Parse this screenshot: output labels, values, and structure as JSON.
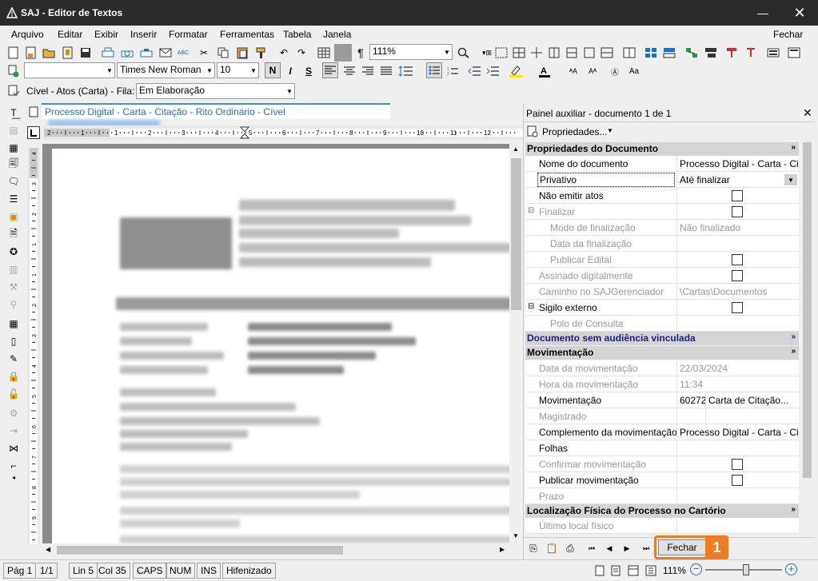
{
  "window": {
    "title": "SAJ - Editor de Textos",
    "minimize": "—",
    "close": "✕"
  },
  "menu": {
    "items": [
      "Arquivo",
      "Editar",
      "Exibir",
      "Inserir",
      "Formatar",
      "Ferramentas",
      "Tabela",
      "Janela"
    ],
    "close_label": "Fechar"
  },
  "toolbar": {
    "zoom": "111%",
    "font_name": "Times New Roman",
    "font_size": "10",
    "bold": "N",
    "italic": "I",
    "strike": "S",
    "pilcrow": "¶"
  },
  "queue": {
    "label": "Cível - Atos (Carta) - Fila:",
    "value": "Em Elaboração"
  },
  "document_tab": {
    "title": "Processo Digital - Carta - Citação - Rito Ordinário - Cível"
  },
  "ruler": {
    "h_ticks": [
      "2",
      "1",
      "1",
      "2",
      "3",
      "4",
      "5",
      "6",
      "7",
      "8",
      "9",
      "10",
      "11",
      "12"
    ],
    "v_ticks": [
      "4",
      "3",
      "2",
      "1",
      "1",
      "2",
      "3",
      "4",
      "5",
      "6",
      "7",
      "8",
      "9"
    ]
  },
  "panel": {
    "title": "Painel auxiliar - documento 1 de 1",
    "properties_button": "Propriedades...",
    "sections": {
      "doc_props": "Propriedades do Documento",
      "no_hearing": "Documento sem audiência vinculada",
      "movement": "Movimentação",
      "location": "Localização Física do Processo no Cartório"
    },
    "rows": {
      "nome": {
        "label": "Nome do documento",
        "value": "Processo Digital - Carta - Ci..."
      },
      "privativo": {
        "label": "Privativo",
        "value": "Até finalizar"
      },
      "nao_emitir": {
        "label": "Não emitir atos"
      },
      "finalizar": {
        "label": "Finalizar"
      },
      "modo_final": {
        "label": "Modo de finalização",
        "value": "Não finalizado"
      },
      "data_final": {
        "label": "Data da finalização"
      },
      "publicar_edital": {
        "label": "Publicar Edital"
      },
      "assinado": {
        "label": "Assinado digitalmente"
      },
      "caminho": {
        "label": "Caminho no SAJGerenciador",
        "value": "\\Cartas\\Documentos"
      },
      "sigilo": {
        "label": "Sigilo externo"
      },
      "polo": {
        "label": "Polo de Consulta"
      },
      "data_mov": {
        "label": "Data da movimentação",
        "value": "22/03/2024"
      },
      "hora_mov": {
        "label": "Hora da movimentação",
        "value": "11:34"
      },
      "movimentacao": {
        "label": "Movimentação",
        "code": "60272",
        "value": "Carta de Citação..."
      },
      "magistrado": {
        "label": "Magistrado"
      },
      "complemento": {
        "label": "Complemento da movimentação",
        "value": "Processo Digital - Carta - Ci..."
      },
      "folhas": {
        "label": "Folhas"
      },
      "confirmar": {
        "label": "Confirmar movimentação"
      },
      "publicar_mov": {
        "label": "Publicar movimentação"
      },
      "prazo": {
        "label": "Prazo"
      },
      "ultimo_local": {
        "label": "Último local físico"
      }
    },
    "close_button": "Fechar",
    "callout": "1"
  },
  "status": {
    "page": "Pág 1",
    "pages": "1/1",
    "line": "Lin 5",
    "col": "Col 35",
    "caps": "CAPS",
    "num": "NUM",
    "ins": "INS",
    "hyph": "Hifenizado",
    "zoom": "111%"
  },
  "colors": {
    "accent": "#3d8ee8",
    "callout": "#f07c22",
    "titlebar": "#2b2b2b",
    "section_blue": "#1c1c8c"
  }
}
